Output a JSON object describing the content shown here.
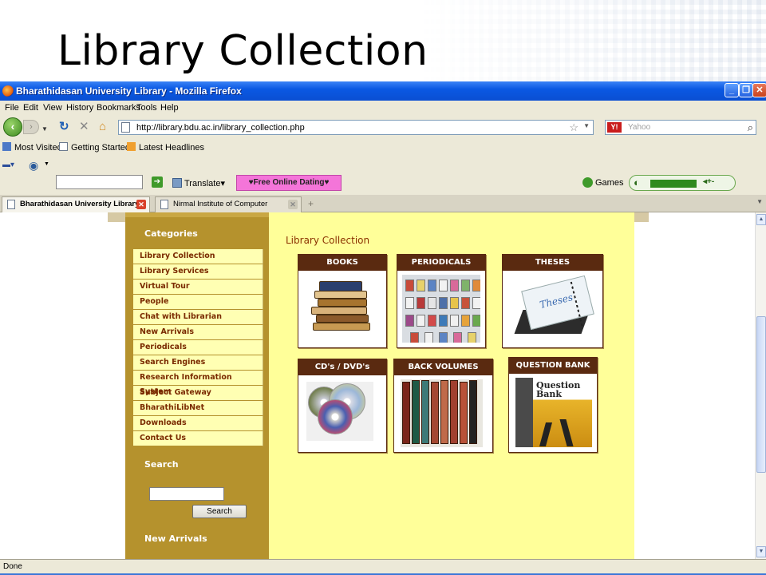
{
  "slide": {
    "title": "Library Collection"
  },
  "window": {
    "title": "Bharathidasan University Library - Mozilla Firefox"
  },
  "menu": [
    "File",
    "Edit",
    "View",
    "History",
    "Bookmarks",
    "Tools",
    "Help"
  ],
  "nav": {
    "url": "http://library.bdu.ac.in/library_collection.php",
    "search_placeholder": "Yahoo",
    "search_engine_icon": "Y!"
  },
  "bookmarks": [
    "Most Visited",
    "Getting Started",
    "Latest Headlines"
  ],
  "toolbar": {
    "translate": "Translate",
    "dating": "♥Free Online Dating♥",
    "games": "Games"
  },
  "tabs": [
    {
      "label": "Bharathidasan University Library",
      "active": true
    },
    {
      "label": "Nirmal Institute of Computer Expertise",
      "active": false
    }
  ],
  "sidebar": {
    "categories_heading": "Categories",
    "categories": [
      "Library Collection",
      "Library Services",
      "Virtual Tour",
      "People",
      "Chat with Librarian",
      "New Arrivals",
      "Periodicals",
      "Search Engines",
      "Research Information System",
      "Subject Gateway",
      "BharathiLibNet",
      "Downloads",
      "Contact Us"
    ],
    "search_heading": "Search",
    "search_button": "Search",
    "new_arrivals_heading": "New Arrivals"
  },
  "main": {
    "title": "Library Collection",
    "boxes": [
      "BOOKS",
      "PERIODICALS",
      "THESES",
      "CD's / DVD's",
      "BACK VOLUMES",
      "QUESTION BANK"
    ],
    "theses_image_text": "Theses",
    "question_bank_image_text": "Question Bank"
  },
  "status": {
    "text": "Done"
  }
}
